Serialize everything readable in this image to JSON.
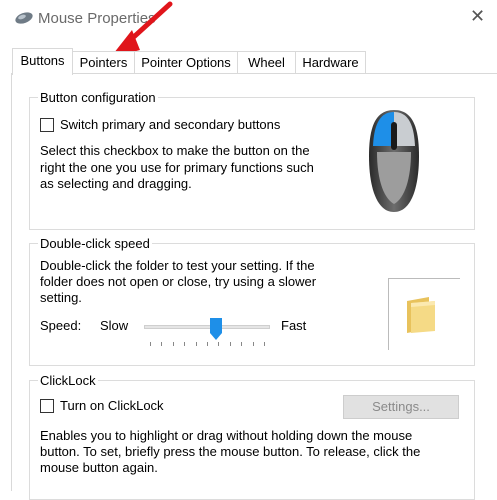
{
  "window": {
    "title": "Mouse Properties",
    "close_icon": "close-icon"
  },
  "tabs": [
    {
      "label": "Buttons",
      "active": true
    },
    {
      "label": "Pointers",
      "active": false
    },
    {
      "label": "Pointer Options",
      "active": false
    },
    {
      "label": "Wheel",
      "active": false
    },
    {
      "label": "Hardware",
      "active": false
    }
  ],
  "button_config": {
    "legend": "Button configuration",
    "checkbox_label": "Switch primary and secondary buttons",
    "checked": false,
    "description_lines": [
      "Select this checkbox to make the button on the",
      "right the one you use for primary functions such",
      "as selecting and dragging."
    ]
  },
  "double_click": {
    "legend": "Double-click speed",
    "description_lines": [
      "Double-click the folder to test your setting. If the",
      "folder does not open or close, try using a slower",
      "setting."
    ],
    "speed_label": "Speed:",
    "slow_label": "Slow",
    "fast_label": "Fast",
    "slider_value_fraction": 0.58
  },
  "clicklock": {
    "legend": "ClickLock",
    "checkbox_label": "Turn on ClickLock",
    "checked": false,
    "settings_button": "Settings...",
    "settings_enabled": false,
    "description_lines": [
      "Enables you to highlight or drag without holding down the mouse",
      "button. To set, briefly press the mouse button. To release, click the",
      "mouse button again."
    ]
  },
  "annotation": {
    "arrow_color": "#e0151b",
    "points_to": "Pointers tab"
  },
  "colors": {
    "accent_blue": "#1e8fe8",
    "folder_yellow": "#f2d27a"
  }
}
